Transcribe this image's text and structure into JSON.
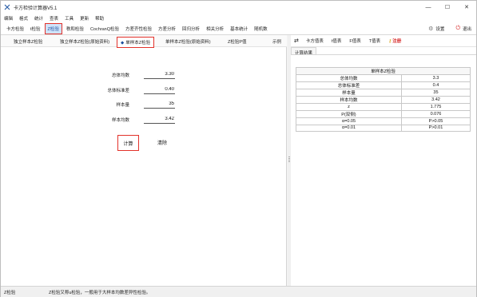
{
  "window": {
    "title": "卡方检验计算器V5.1",
    "minimize": "—",
    "maximize": "☐",
    "close": "✕"
  },
  "menu": [
    "编辑",
    "格式",
    "统计",
    "查表",
    "工具",
    "更新",
    "帮助"
  ],
  "tool_tabs": [
    {
      "label": "卡方检验",
      "active": false
    },
    {
      "label": "t检验",
      "active": false
    },
    {
      "label": "Z检验",
      "active": true
    },
    {
      "label": "秩和检验",
      "active": false
    },
    {
      "label": "CochranQ检验",
      "active": false
    },
    {
      "label": "方差齐性检验",
      "active": false
    },
    {
      "label": "方差分析",
      "active": false
    },
    {
      "label": "回归分析",
      "active": false
    },
    {
      "label": "相关分析",
      "active": false
    },
    {
      "label": "基本统计",
      "active": false
    },
    {
      "label": "随机数",
      "active": false
    }
  ],
  "settings_label": "设置",
  "exit_label": "退出",
  "sub_tabs": [
    {
      "label": "独立样本Z检验"
    },
    {
      "label": "独立样本Z检验(原始资料)"
    },
    {
      "label": "单样本Z检验"
    },
    {
      "label": "单样本Z检验(原始资料)"
    },
    {
      "label": "Z检验P值"
    },
    {
      "label": "示例"
    }
  ],
  "form": {
    "population_mean_label": "总体均数",
    "population_mean_value": "3.30",
    "population_sd_label": "总体标准差",
    "population_sd_value": "0.40",
    "sample_size_label": "样本量",
    "sample_size_value": "35",
    "sample_mean_label": "样本均数",
    "sample_mean_value": "3.42",
    "calc_button": "计算",
    "clear_button": "清除"
  },
  "right_tabs": [
    {
      "label": "⇄"
    },
    {
      "label": "卡方值表"
    },
    {
      "label": "t值表"
    },
    {
      "label": "F值表"
    },
    {
      "label": "T值表"
    },
    {
      "label": "注册"
    }
  ],
  "result_tab_label": "计算结果",
  "result_table": {
    "title": "单样本Z检验",
    "rows": [
      [
        "总体均数",
        "3.3"
      ],
      [
        "总体标准差",
        "0.4"
      ],
      [
        "样本量",
        "35"
      ],
      [
        "样本均数",
        "3.42"
      ],
      [
        "z",
        "1.775"
      ],
      [
        "P(双侧)",
        "0.076"
      ],
      [
        "α=0.05",
        "P>0.05"
      ],
      [
        "α=0.01",
        "P>0.01"
      ]
    ]
  },
  "status": {
    "left": "Z检验",
    "message": "Z检验又称u检验，一般用于大样本均数差异性检验。"
  },
  "colors": {
    "highlight_border": "#e2322b",
    "active_tab_bg": "#cfe3fb",
    "register_text": "#d42020"
  }
}
